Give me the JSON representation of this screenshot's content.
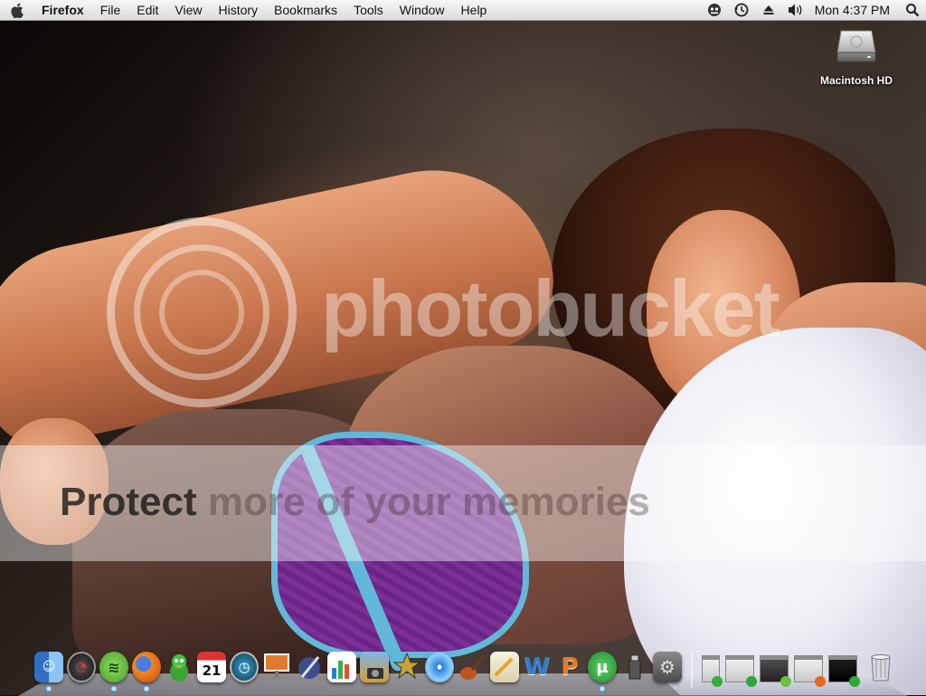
{
  "menubar": {
    "app_name": "Firefox",
    "menus": [
      "File",
      "Edit",
      "View",
      "History",
      "Bookmarks",
      "Tools",
      "Window",
      "Help"
    ],
    "clock": "Mon 4:37 PM",
    "status_icons": [
      "skype-icon",
      "time-machine-icon",
      "eject-icon",
      "volume-icon",
      "spotlight-icon"
    ]
  },
  "desktop": {
    "drive_label": "Macintosh HD"
  },
  "watermark": {
    "brand": "photobucket",
    "band_text_dark": "Protect ",
    "band_text_faint": "more of your memories"
  },
  "dock": {
    "apps": [
      {
        "name": "finder-icon",
        "running": true
      },
      {
        "name": "dashboard-icon",
        "running": false
      },
      {
        "name": "spotify-icon",
        "running": true
      },
      {
        "name": "firefox-icon",
        "running": true
      },
      {
        "name": "adium-icon",
        "running": false
      },
      {
        "name": "ical-icon",
        "glyph": "21",
        "running": false
      },
      {
        "name": "time-machine-dock-icon",
        "running": false
      },
      {
        "name": "keynote-icon",
        "running": false
      },
      {
        "name": "script-editor-icon",
        "running": false
      },
      {
        "name": "numbers-icon",
        "running": false
      },
      {
        "name": "iphoto-icon",
        "running": false
      },
      {
        "name": "imovie-icon",
        "running": false
      },
      {
        "name": "dvd-player-icon",
        "running": false
      },
      {
        "name": "garageband-icon",
        "running": false
      },
      {
        "name": "pages-icon",
        "running": false
      },
      {
        "name": "word-icon",
        "glyph": "W",
        "running": false
      },
      {
        "name": "powerpoint-icon",
        "glyph": "P",
        "running": false
      },
      {
        "name": "utorrent-icon",
        "glyph": "µ",
        "running": true
      },
      {
        "name": "usb-drive-icon",
        "running": false
      },
      {
        "name": "system-preferences-icon",
        "running": false
      }
    ],
    "minimized": [
      "minimized-window-1",
      "minimized-window-2",
      "minimized-window-3",
      "minimized-window-4",
      "minimized-window-5"
    ],
    "colors": {
      "finder": "#4a8fd8",
      "spotify": "#6ac13f",
      "firefox": "#e8661e",
      "adium": "#3aaa3a",
      "utorrent": "#2fa53a",
      "word": "#2a7fd6",
      "powerpoint": "#e87b1c"
    }
  }
}
